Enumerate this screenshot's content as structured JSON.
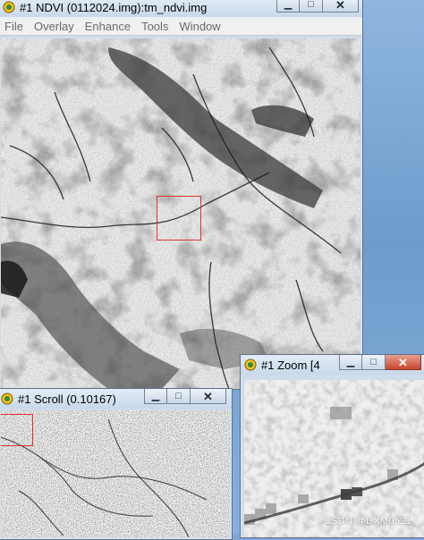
{
  "main_window": {
    "title": "#1 NDVI (0112024.img):tm_ndvi.img",
    "menu": [
      "File",
      "Overlay",
      "Enhance",
      "Tools",
      "Window"
    ]
  },
  "scroll_window": {
    "title": "#1 Scroll (0.10167)"
  },
  "zoom_window": {
    "title": "#1 Zoom [4"
  },
  "caption_buttons": {
    "minimize": "▁",
    "maximize": "□",
    "close": "✕"
  },
  "watermark": "CSDN @DXM0521",
  "colors": {
    "selection_box": "#e0322c"
  }
}
